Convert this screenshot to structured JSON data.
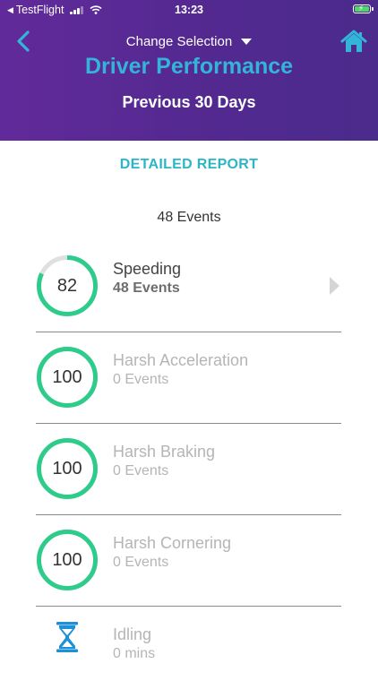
{
  "status_bar": {
    "back_app": "TestFlight",
    "time": "13:23"
  },
  "header": {
    "change_selection": "Change Selection",
    "title": "Driver Performance",
    "period": "Previous 30 Days"
  },
  "report": {
    "detailed_label": "DETAILED REPORT",
    "total_events": "48 Events"
  },
  "colors": {
    "header_purple": "#5a2a94",
    "title_cyan": "#33b4d8",
    "ring_green": "#2ecc8a",
    "ring_track": "#e0e0e0",
    "hourglass_blue": "#1f8fd8"
  },
  "categories": [
    {
      "name": "Speeding",
      "sub": "48 Events",
      "score": "82",
      "score_fraction": 0.82,
      "active": true
    },
    {
      "name": "Harsh Acceleration",
      "sub": "0 Events",
      "score": "100",
      "score_fraction": 1.0,
      "active": false
    },
    {
      "name": "Harsh Braking",
      "sub": "0 Events",
      "score": "100",
      "score_fraction": 1.0,
      "active": false
    },
    {
      "name": "Harsh Cornering",
      "sub": "0 Events",
      "score": "100",
      "score_fraction": 1.0,
      "active": false
    },
    {
      "name": "Idling",
      "sub": "0 mins",
      "icon": "hourglass-icon",
      "active": false
    }
  ]
}
